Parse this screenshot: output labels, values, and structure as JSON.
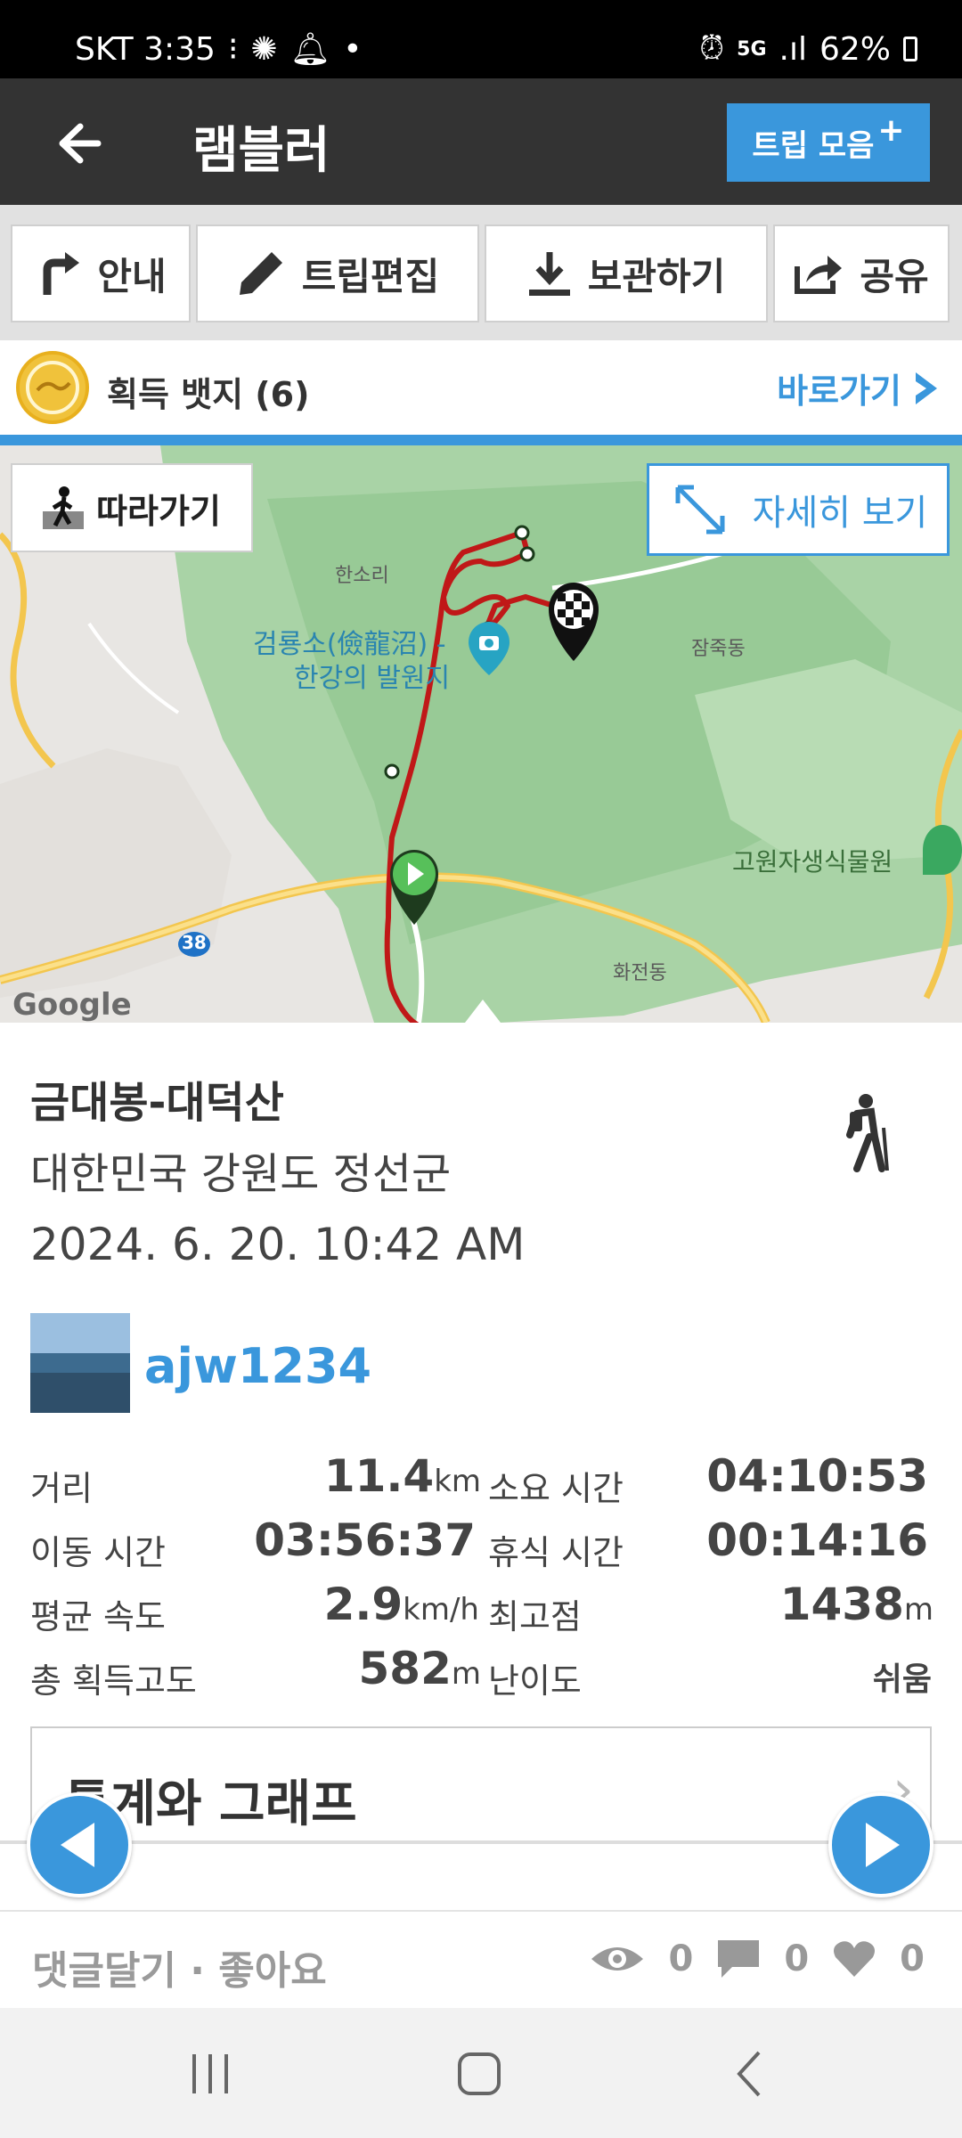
{
  "status_bar": {
    "carrier_time": "SKT 3:35",
    "battery": "62%",
    "network": "5G"
  },
  "app_bar": {
    "title": "램블러",
    "trip_button": "트립 모음"
  },
  "toolbar": {
    "guide": "안내",
    "edit": "트립편집",
    "save": "보관하기",
    "share": "공유"
  },
  "badges": {
    "label": "획득 뱃지 (6)",
    "go": "바로가기"
  },
  "map": {
    "follow": "따라가기",
    "detail": "자세히 보기",
    "places": {
      "hansori": "한소리",
      "geomryongso_1": "검룡소(儉龍沼) -",
      "geomryongso_2": "한강의 발원지",
      "jamjuk": "잠죽동",
      "plant_garden": "고원자생식물원",
      "hwajeon": "화전동",
      "route": "38"
    },
    "attribution": "Google"
  },
  "trip": {
    "title": "금대봉-대덕산",
    "location": "대한민국 강원도 정선군",
    "date": "2024. 6. 20. 10:42 AM",
    "user": "ajw1234"
  },
  "stats": {
    "distance_label": "거리",
    "distance_value": "11.4",
    "distance_unit": "km",
    "duration_label": "소요 시간",
    "duration_value": "04:10:53",
    "moving_label": "이동 시간",
    "moving_value": "03:56:37",
    "rest_label": "휴식 시간",
    "rest_value": "00:14:16",
    "speed_label": "평균 속도",
    "speed_value": "2.9",
    "speed_unit": "km/h",
    "max_label": "최고점",
    "max_value": "1438",
    "max_unit": "m",
    "ascent_label": "총 획득고도",
    "ascent_value": "582",
    "ascent_unit": "m",
    "difficulty_label": "난이도",
    "difficulty_value": "쉬움"
  },
  "stats_graph": {
    "label": "통계와 그래프"
  },
  "bottom": {
    "comment_like": "댓글달기 · 좋아요",
    "views": "0",
    "comments": "0",
    "likes": "0"
  },
  "colors": {
    "accent": "#3a97dc",
    "appbar": "#333333",
    "route": "#c01818"
  }
}
